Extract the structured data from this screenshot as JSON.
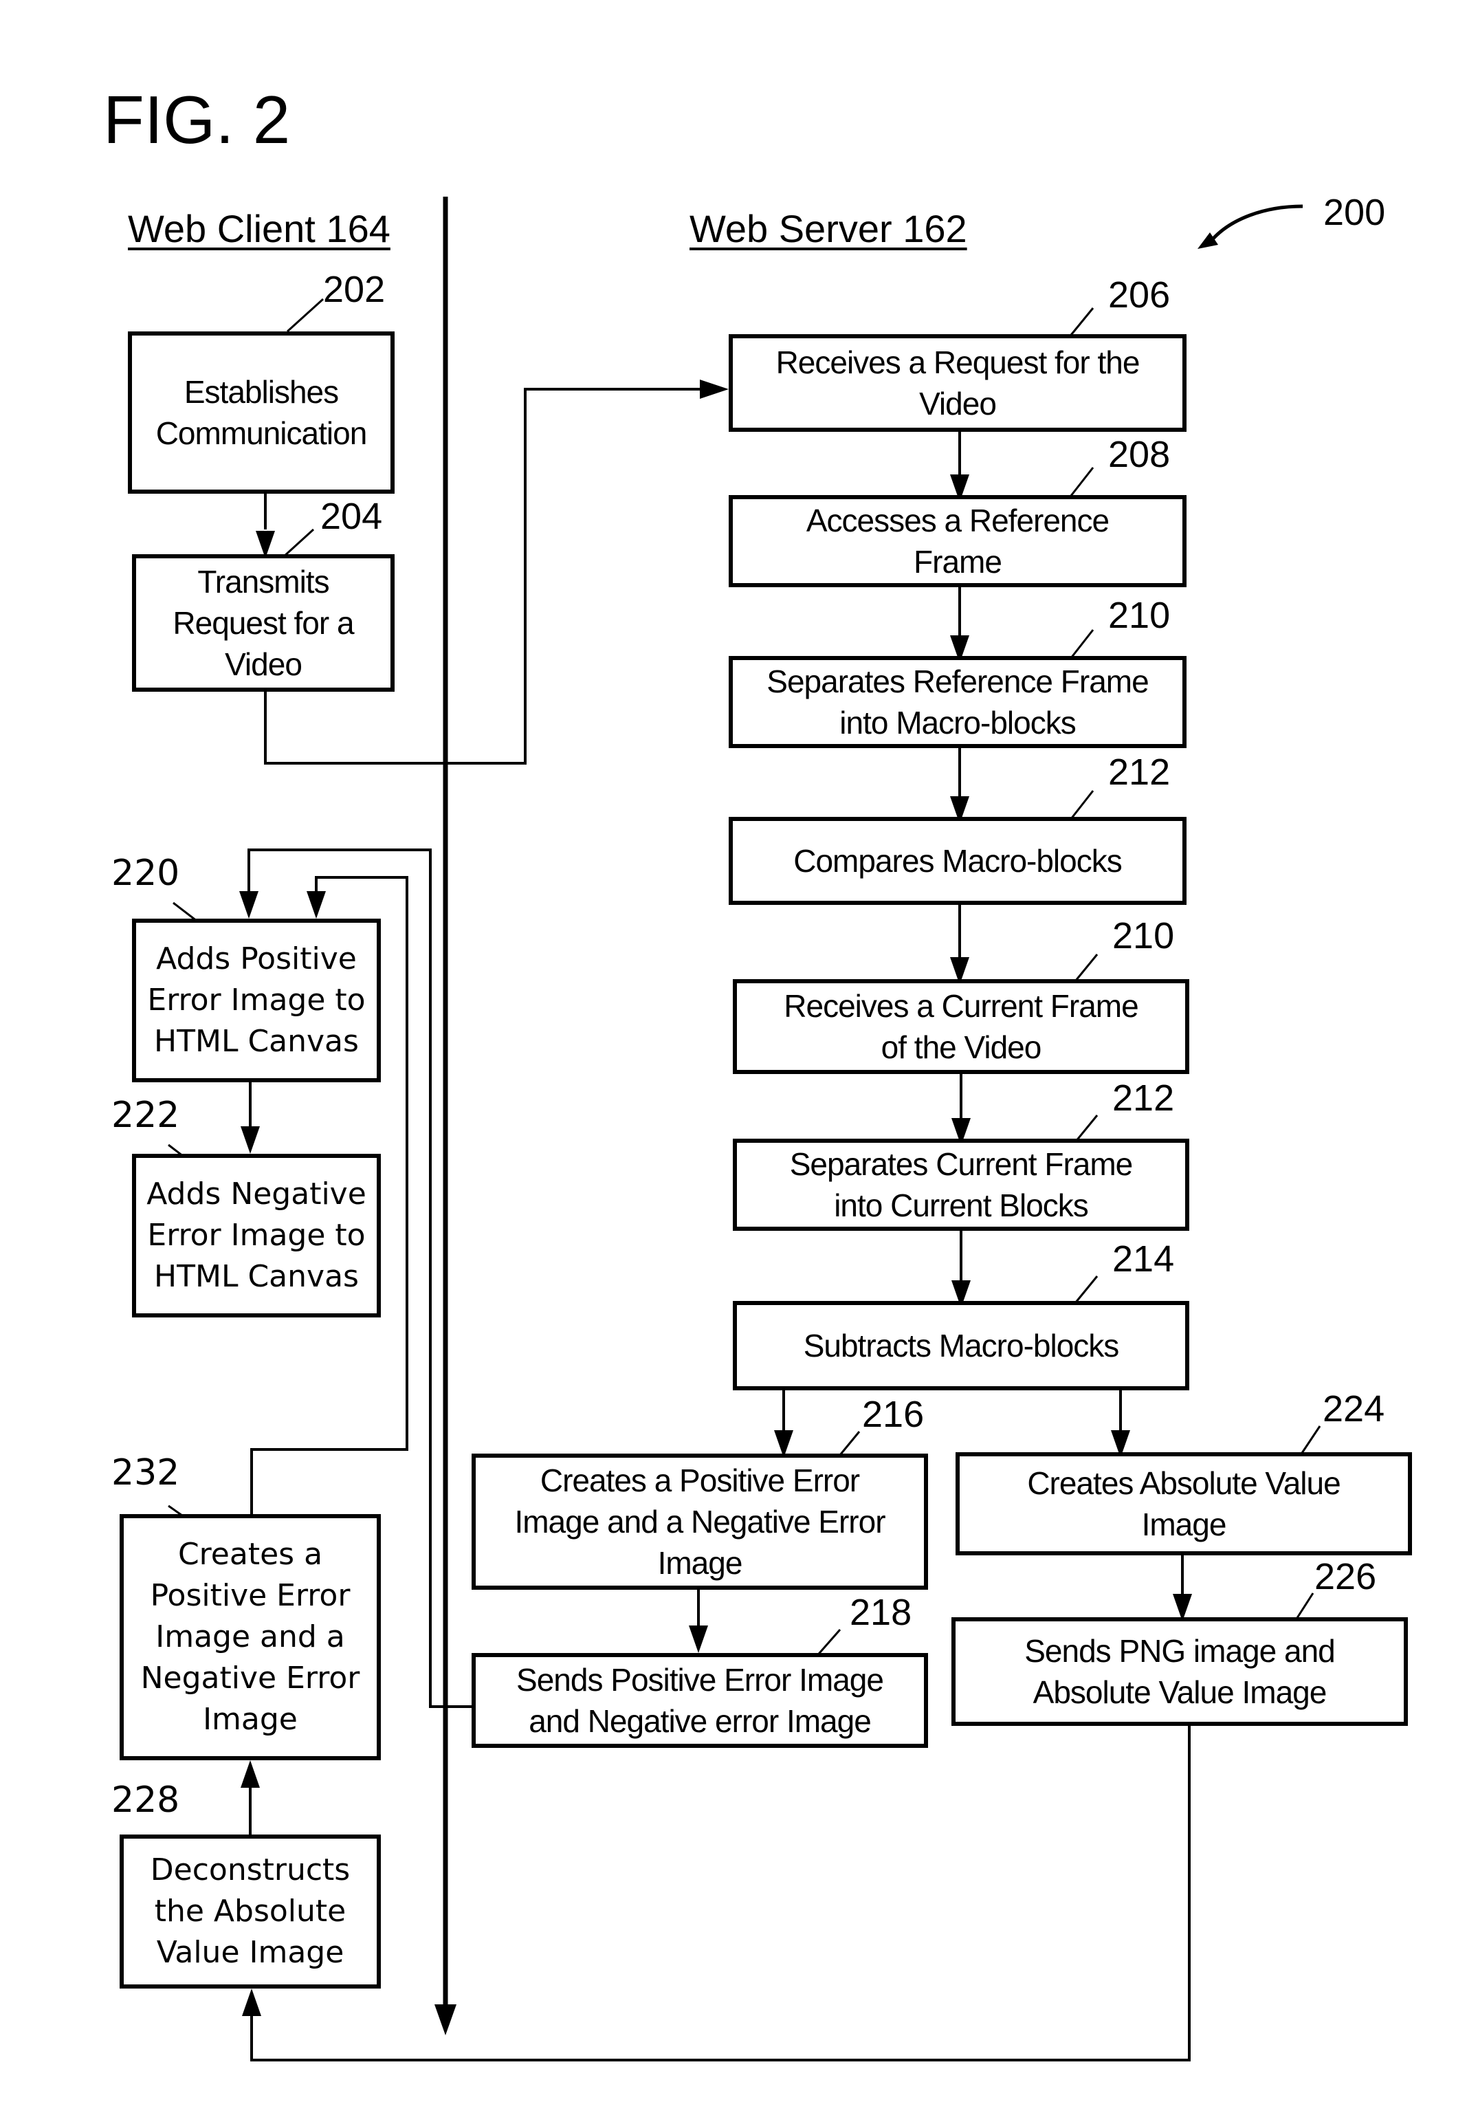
{
  "figure": {
    "title": "FIG. 2",
    "reference": "200"
  },
  "lanes": {
    "client": "Web Client 164",
    "server": "Web Server 162"
  },
  "steps": {
    "s202": {
      "ref": "202",
      "text": "Establishes\nCommunication"
    },
    "s204": {
      "ref": "204",
      "text": "Transmits\nRequest for a\nVideo"
    },
    "s206": {
      "ref": "206",
      "text": "Receives a Request for the\nVideo"
    },
    "s208": {
      "ref": "208",
      "text": "Accesses a Reference\nFrame"
    },
    "s210a": {
      "ref": "210",
      "text": "Separates Reference Frame\ninto Macro-blocks"
    },
    "s212a": {
      "ref": "212",
      "text": "Compares Macro-blocks"
    },
    "s210b": {
      "ref": "210",
      "text": "Receives a Current Frame\nof the Video"
    },
    "s212b": {
      "ref": "212",
      "text": "Separates Current Frame\ninto Current Blocks"
    },
    "s214": {
      "ref": "214",
      "text": "Subtracts Macro-blocks"
    },
    "s216": {
      "ref": "216",
      "text": "Creates a Positive Error\nImage and a Negative Error\nImage"
    },
    "s218": {
      "ref": "218",
      "text": "Sends Positive Error Image\nand Negative error Image"
    },
    "s224": {
      "ref": "224",
      "text": "Creates Absolute Value\nImage"
    },
    "s226": {
      "ref": "226",
      "text": "Sends PNG image and\nAbsolute Value Image"
    },
    "s220": {
      "ref": "220",
      "text": "Adds Positive\nError Image to\nHTML Canvas"
    },
    "s222": {
      "ref": "222",
      "text": "Adds Negative\nError Image to\nHTML Canvas"
    },
    "s232": {
      "ref": "232",
      "text": "Creates a\nPositive Error\nImage and a\nNegative Error\nImage"
    },
    "s228": {
      "ref": "228",
      "text": "Deconstructs\nthe Absolute\nValue Image"
    }
  }
}
